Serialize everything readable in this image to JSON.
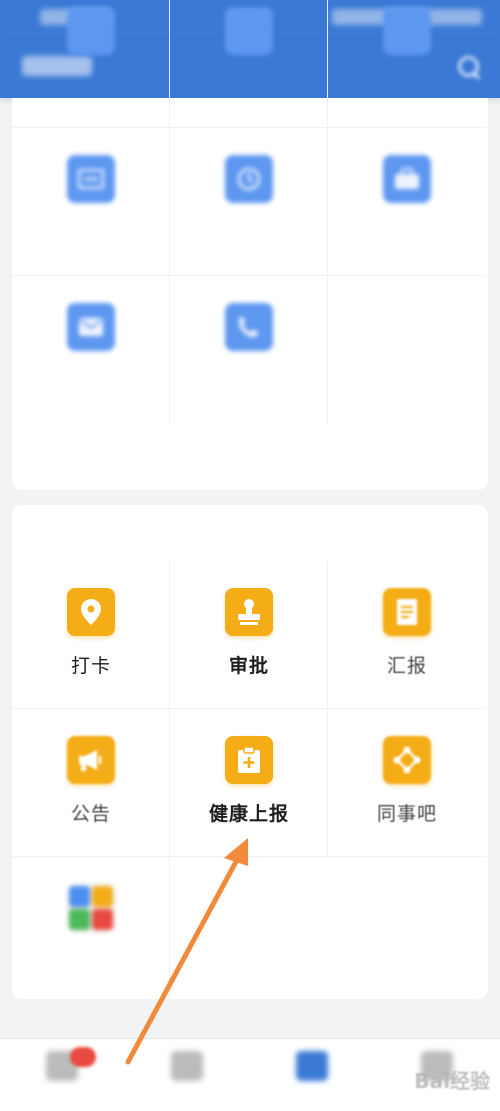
{
  "status_bar": {
    "left_text": "",
    "right_text": ""
  },
  "header": {
    "title": ""
  },
  "top_grid": {
    "items": [
      {
        "label": "",
        "icon": "app-icon"
      },
      {
        "label": "",
        "icon": "app-icon"
      },
      {
        "label": "",
        "icon": "app-icon"
      },
      {
        "label": "",
        "icon": "app-icon"
      },
      {
        "label": "",
        "icon": "clock-icon"
      },
      {
        "label": "",
        "icon": "briefcase-icon"
      },
      {
        "label": "",
        "icon": "mail-icon"
      },
      {
        "label": "",
        "icon": "phone-icon"
      }
    ]
  },
  "office": {
    "title": "",
    "items": [
      {
        "label": "打卡",
        "icon": "location-pin-icon"
      },
      {
        "label": "审批",
        "icon": "stamp-icon"
      },
      {
        "label": "汇报",
        "icon": "document-icon"
      },
      {
        "label": "公告",
        "icon": "megaphone-icon"
      },
      {
        "label": "健康上报",
        "icon": "clipboard-plus-icon"
      },
      {
        "label": "同事吧",
        "icon": "network-icon"
      },
      {
        "label": "",
        "icon": "colorful-grid-icon"
      }
    ]
  },
  "tabbar": {
    "tabs": [
      {
        "label": "",
        "icon": "message-icon",
        "active": false
      },
      {
        "label": "",
        "icon": "contacts-icon",
        "active": false
      },
      {
        "label": "",
        "icon": "workbench-icon",
        "active": true
      },
      {
        "label": "",
        "icon": "profile-icon",
        "active": false
      }
    ]
  },
  "watermark": {
    "text": "Bai经验"
  },
  "colors": {
    "primary": "#3a79d6",
    "office_icon": "#f5ad17",
    "badge": "#e94a3f"
  }
}
